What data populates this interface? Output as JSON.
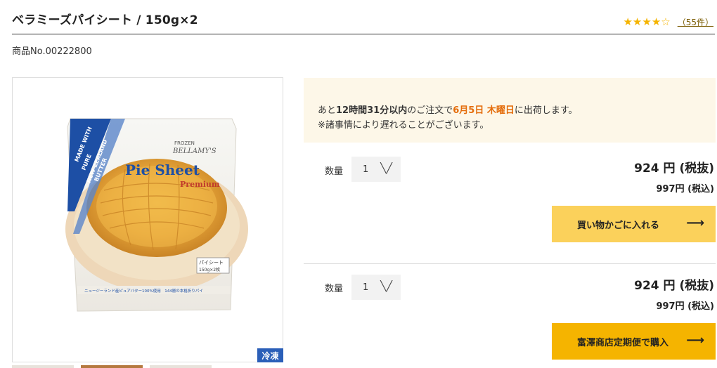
{
  "product": {
    "title": "ベラミーズパイシート / 150g×2",
    "product_no": "商品No.00222800",
    "rating": 4,
    "rating_max": 5,
    "review_count": "（55件）",
    "cold_badge": "冷凍"
  },
  "package": {
    "frozen": "FROZEN",
    "brand": "BELLAMY'S",
    "ribbon": [
      "MADE WITH",
      "PURE",
      "NEW ZEALAND",
      "BUTTER"
    ],
    "name": "Pie Sheet",
    "variant": "Premium",
    "box_line1": "パイシート",
    "box_line2": "150g×2枚",
    "footer": "ニュージーランド産ピュアバター100%使用　144層の本格折りパイ"
  },
  "shipping_notice": {
    "prefix": "あと",
    "time_left": "12時間31分以内",
    "mid": "のご注文で",
    "date": "6月5日 木曜日",
    "suffix": "に出荷します。",
    "note": "※諸事情により遅れることがございます。"
  },
  "purchase_options": [
    {
      "qty_label": "数量",
      "qty_value": "1",
      "price_ex_tax": "924 円 (税抜)",
      "price_in_tax": "997円 (税込)",
      "button_label": "買い物かごに入れる"
    },
    {
      "qty_label": "数量",
      "qty_value": "1",
      "price_ex_tax": "924 円 (税抜)",
      "price_in_tax": "997円 (税込)",
      "button_label": "富澤商店定期便で購入"
    }
  ],
  "colors": {
    "star": "#f5b400",
    "cart_button": "#fbd15b",
    "subscription_button": "#f5b400",
    "highlight": "#e46c0a",
    "cold_badge": "#2b5fb8",
    "notice_bg": "#fdf7e8"
  }
}
